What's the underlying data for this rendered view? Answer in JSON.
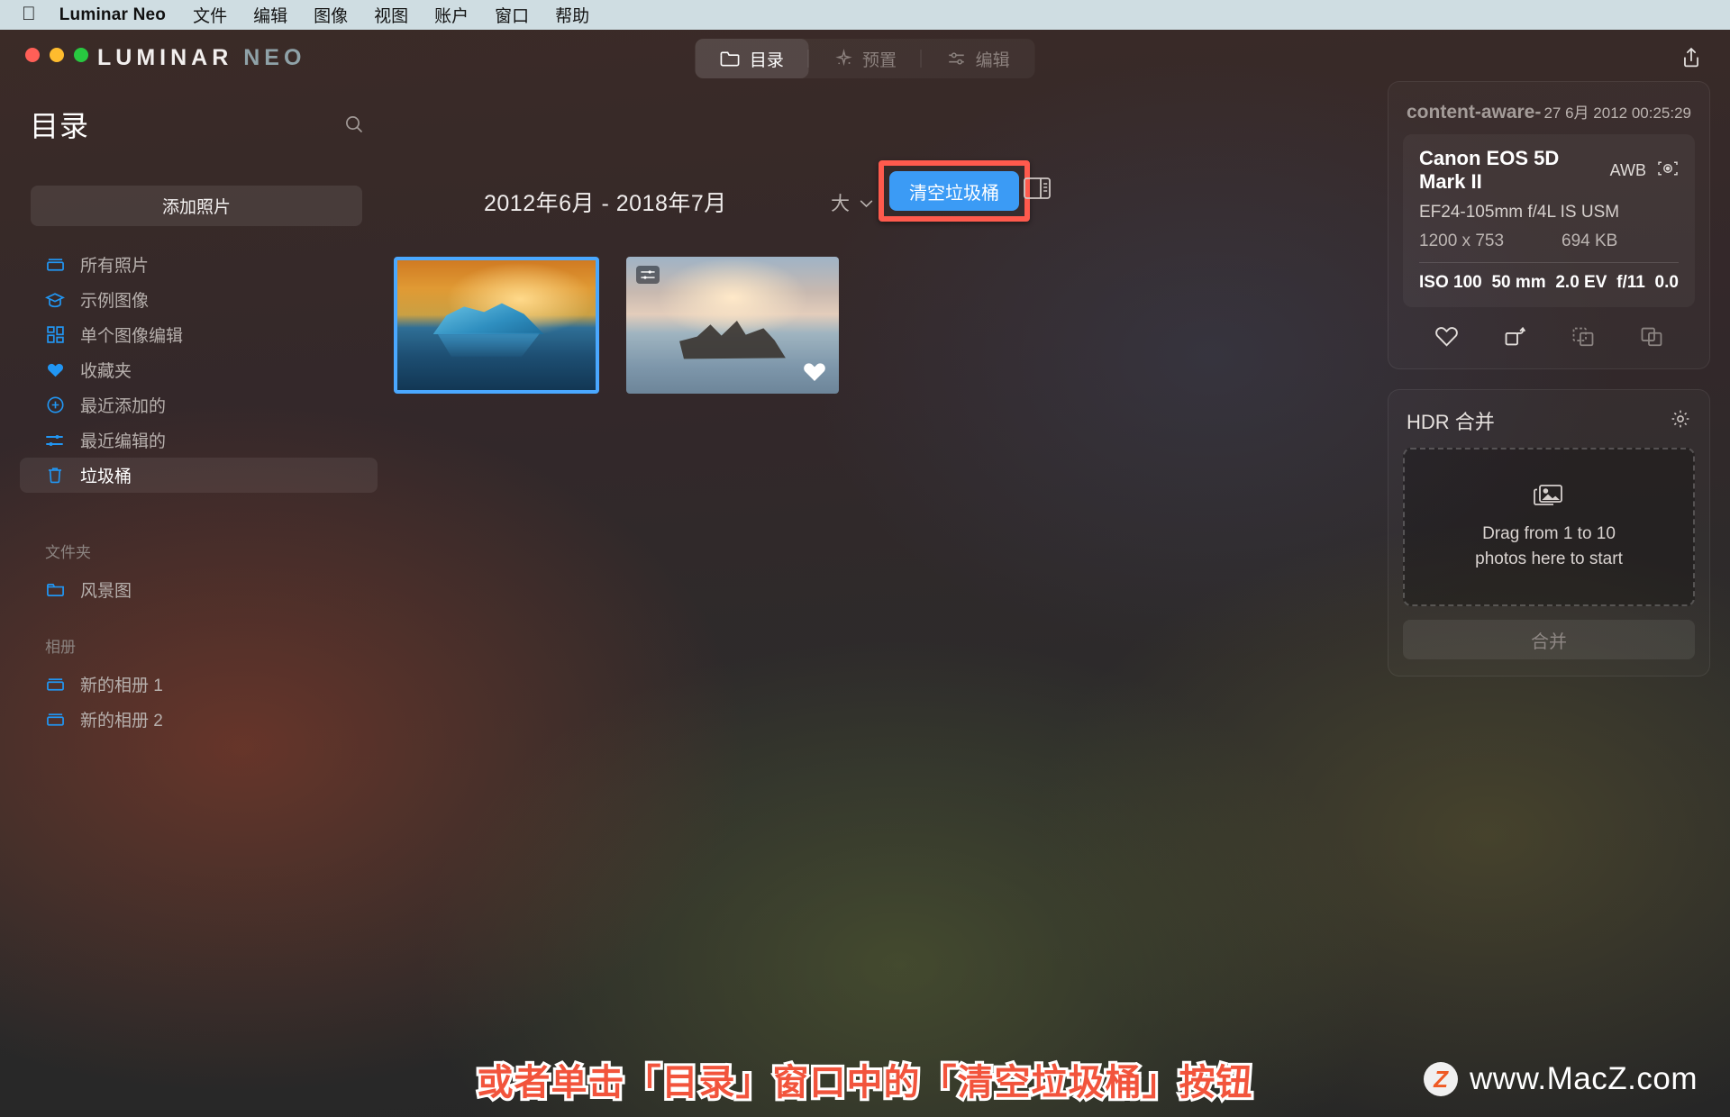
{
  "menubar": {
    "apple_icon": "apple-logo",
    "app_name": "Luminar Neo",
    "items": [
      "文件",
      "编辑",
      "图像",
      "视图",
      "账户",
      "窗口",
      "帮助"
    ]
  },
  "window": {
    "logo_main": "LUMINAR",
    "logo_sub": "NEO",
    "share_icon": "share-icon",
    "tabs": [
      {
        "label": "目录",
        "icon": "folder-icon",
        "active": true
      },
      {
        "label": "预置",
        "icon": "sparkle-icon",
        "active": false
      },
      {
        "label": "编辑",
        "icon": "sliders-icon",
        "active": false
      }
    ]
  },
  "sidebar": {
    "title": "目录",
    "search_icon": "search-icon",
    "add_photos_label": "添加照片",
    "items": [
      {
        "label": "所有照片",
        "icon": "library-icon",
        "active": false
      },
      {
        "label": "示例图像",
        "icon": "graduation-cap-icon",
        "active": false
      },
      {
        "label": "单个图像编辑",
        "icon": "grid-icon",
        "active": false
      },
      {
        "label": "收藏夹",
        "icon": "heart-filled-icon",
        "active": false
      },
      {
        "label": "最近添加的",
        "icon": "plus-circle-icon",
        "active": false
      },
      {
        "label": "最近编辑的",
        "icon": "sliders-icon",
        "active": false
      },
      {
        "label": "垃圾桶",
        "icon": "trash-icon",
        "active": true
      }
    ],
    "folders_section_label": "文件夹",
    "folders": [
      {
        "label": "风景图",
        "icon": "folder-icon"
      }
    ],
    "albums_section_label": "相册",
    "albums": [
      {
        "label": "新的相册 1",
        "icon": "album-icon"
      },
      {
        "label": "新的相册 2",
        "icon": "album-icon"
      }
    ]
  },
  "content": {
    "date_range": "2012年6月 - 2018年7月",
    "size_selector": {
      "label": "大",
      "chevron": "chevron-down-icon"
    },
    "empty_trash_button": "清空垃圾桶",
    "panel_toggle_icon": "right-panel-icon",
    "thumbnails": [
      {
        "name": "iceberg-sunset-photo",
        "selected": true,
        "favorite": false
      },
      {
        "name": "driftwood-beach-photo",
        "selected": false,
        "favorite": true,
        "badge_icon": "sliders-icon",
        "heart_icon": "heart-filled-icon"
      }
    ]
  },
  "info_panel": {
    "file_name": "content-aware-",
    "capture_date": "27 6月 2012 00:25:29",
    "camera": "Canon EOS 5D Mark II",
    "white_balance": "AWB",
    "camera_icon": "camera-metering-icon",
    "lens": "EF24-105mm f/4L IS USM",
    "dimensions": "1200 x 753",
    "file_size": "694 KB",
    "exif": [
      "ISO 100",
      "50 mm",
      "2.0 EV",
      "f/11",
      "0.0"
    ],
    "actions": [
      {
        "icon": "heart-outline-icon",
        "enabled": true
      },
      {
        "icon": "rotate-icon",
        "enabled": true
      },
      {
        "icon": "copy-dashed-icon",
        "enabled": false
      },
      {
        "icon": "copy-icon",
        "enabled": false
      }
    ]
  },
  "hdr_panel": {
    "title": "HDR 合并",
    "settings_icon": "gear-icon",
    "dropzone_icon": "photos-stack-icon",
    "dropzone_line1": "Drag from 1 to 10",
    "dropzone_line2": "photos here to start",
    "merge_button": "合并"
  },
  "annotation": {
    "caption": "或者单击「目录」窗口中的「清空垃圾桶」按钮",
    "highlight_color": "#ff5a4d"
  },
  "watermark": {
    "badge": "Z",
    "text": "www.MacZ.com"
  },
  "colors": {
    "accent_blue": "#3b9bf5",
    "icon_blue": "#2196f3",
    "highlight_red": "#ff5a4d",
    "menubar_bg": "#cfdde2"
  }
}
